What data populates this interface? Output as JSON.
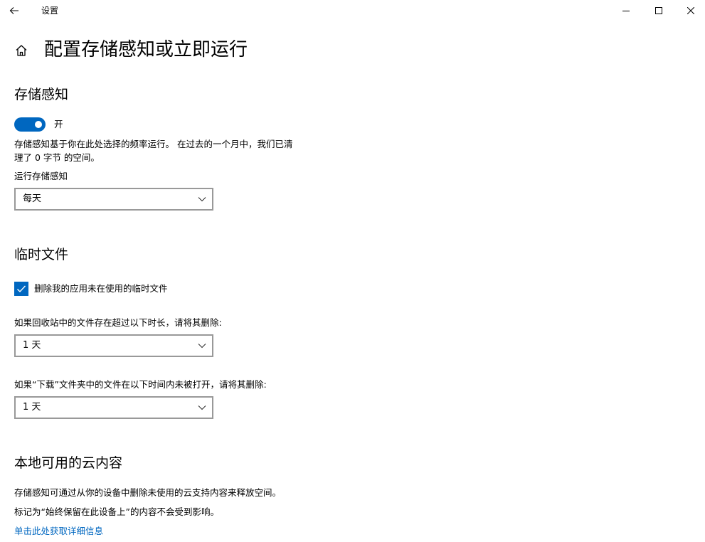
{
  "window": {
    "title": "设置",
    "back_icon": "arrow-left-icon",
    "minimize_icon": "minimize-icon",
    "maximize_icon": "maximize-icon",
    "close_icon": "close-icon"
  },
  "header": {
    "home_icon": "home-icon",
    "title": "配置存储感知或立即运行"
  },
  "storage_sense": {
    "title": "存储感知",
    "toggle_state": "开",
    "toggle_on": true,
    "description_line1": "存储感知基于你在此处选择的频率运行。 在过去的一个月中，我们已清",
    "description_line2": "理了 0 字节 的空间。",
    "run_label": "运行存储感知",
    "run_value": "每天"
  },
  "temp_files": {
    "title": "临时文件",
    "delete_app_temp_label": "删除我的应用未在使用的临时文件",
    "delete_app_temp_checked": true,
    "recycle_label": "如果回收站中的文件存在超过以下时长，请将其删除:",
    "recycle_value": "1 天",
    "downloads_label": "如果“下载”文件夹中的文件在以下时间内未被打开，请将其删除:",
    "downloads_value": "1 天"
  },
  "cloud": {
    "title": "本地可用的云内容",
    "line1": "存储感知可通过从你的设备中删除未使用的云支持内容来释放空间。",
    "line2": "标记为“始终保留在此设备上”的内容不会受到影响。",
    "link": "单击此处获取详细信息"
  },
  "colors": {
    "accent": "#0067c0",
    "dropdown_border": "#999999"
  }
}
